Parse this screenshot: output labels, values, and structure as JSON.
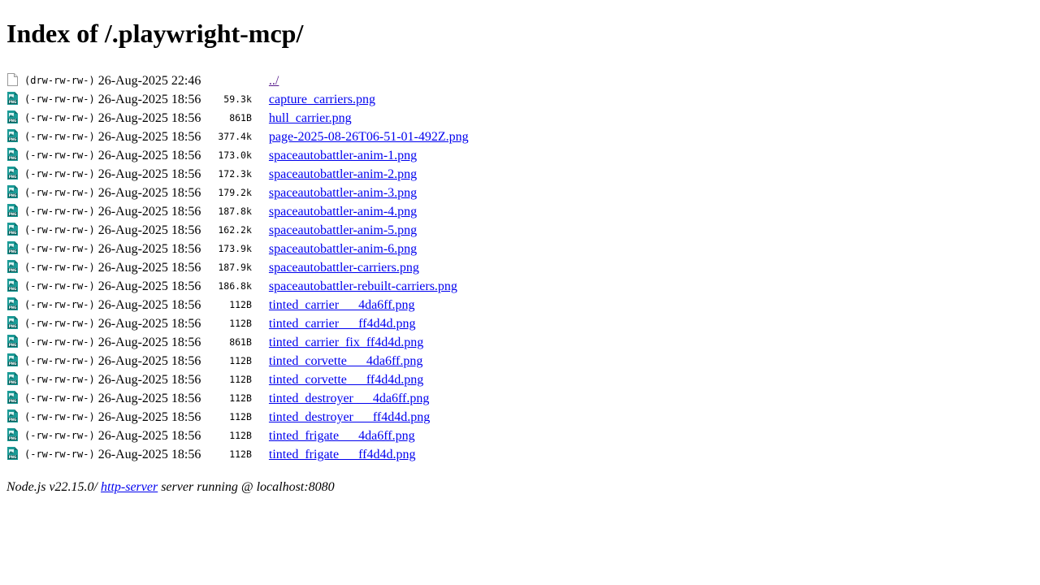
{
  "page": {
    "title": "Index of /.playwright-mcp/"
  },
  "entries": [
    {
      "icon": "folder-file-icon",
      "perms": "(drw-rw-rw-)",
      "date": "26-Aug-2025 22:46",
      "size": "",
      "name": "../",
      "visited": true
    },
    {
      "icon": "png-file-icon",
      "perms": "(-rw-rw-rw-)",
      "date": "26-Aug-2025 18:56",
      "size": "59.3k",
      "name": "capture_carriers.png"
    },
    {
      "icon": "png-file-icon",
      "perms": "(-rw-rw-rw-)",
      "date": "26-Aug-2025 18:56",
      "size": "861B",
      "name": "hull_carrier.png"
    },
    {
      "icon": "png-file-icon",
      "perms": "(-rw-rw-rw-)",
      "date": "26-Aug-2025 18:56",
      "size": "377.4k",
      "name": "page-2025-08-26T06-51-01-492Z.png"
    },
    {
      "icon": "png-file-icon",
      "perms": "(-rw-rw-rw-)",
      "date": "26-Aug-2025 18:56",
      "size": "173.0k",
      "name": "spaceautobattler-anim-1.png"
    },
    {
      "icon": "png-file-icon",
      "perms": "(-rw-rw-rw-)",
      "date": "26-Aug-2025 18:56",
      "size": "172.3k",
      "name": "spaceautobattler-anim-2.png"
    },
    {
      "icon": "png-file-icon",
      "perms": "(-rw-rw-rw-)",
      "date": "26-Aug-2025 18:56",
      "size": "179.2k",
      "name": "spaceautobattler-anim-3.png"
    },
    {
      "icon": "png-file-icon",
      "perms": "(-rw-rw-rw-)",
      "date": "26-Aug-2025 18:56",
      "size": "187.8k",
      "name": "spaceautobattler-anim-4.png"
    },
    {
      "icon": "png-file-icon",
      "perms": "(-rw-rw-rw-)",
      "date": "26-Aug-2025 18:56",
      "size": "162.2k",
      "name": "spaceautobattler-anim-5.png"
    },
    {
      "icon": "png-file-icon",
      "perms": "(-rw-rw-rw-)",
      "date": "26-Aug-2025 18:56",
      "size": "173.9k",
      "name": "spaceautobattler-anim-6.png"
    },
    {
      "icon": "png-file-icon",
      "perms": "(-rw-rw-rw-)",
      "date": "26-Aug-2025 18:56",
      "size": "187.9k",
      "name": "spaceautobattler-carriers.png"
    },
    {
      "icon": "png-file-icon",
      "perms": "(-rw-rw-rw-)",
      "date": "26-Aug-2025 18:56",
      "size": "186.8k",
      "name": "spaceautobattler-rebuilt-carriers.png"
    },
    {
      "icon": "png-file-icon",
      "perms": "(-rw-rw-rw-)",
      "date": "26-Aug-2025 18:56",
      "size": "112B",
      "name": "tinted_carrier___4da6ff.png"
    },
    {
      "icon": "png-file-icon",
      "perms": "(-rw-rw-rw-)",
      "date": "26-Aug-2025 18:56",
      "size": "112B",
      "name": "tinted_carrier___ff4d4d.png"
    },
    {
      "icon": "png-file-icon",
      "perms": "(-rw-rw-rw-)",
      "date": "26-Aug-2025 18:56",
      "size": "861B",
      "name": "tinted_carrier_fix_ff4d4d.png"
    },
    {
      "icon": "png-file-icon",
      "perms": "(-rw-rw-rw-)",
      "date": "26-Aug-2025 18:56",
      "size": "112B",
      "name": "tinted_corvette___4da6ff.png"
    },
    {
      "icon": "png-file-icon",
      "perms": "(-rw-rw-rw-)",
      "date": "26-Aug-2025 18:56",
      "size": "112B",
      "name": "tinted_corvette___ff4d4d.png"
    },
    {
      "icon": "png-file-icon",
      "perms": "(-rw-rw-rw-)",
      "date": "26-Aug-2025 18:56",
      "size": "112B",
      "name": "tinted_destroyer___4da6ff.png"
    },
    {
      "icon": "png-file-icon",
      "perms": "(-rw-rw-rw-)",
      "date": "26-Aug-2025 18:56",
      "size": "112B",
      "name": "tinted_destroyer___ff4d4d.png"
    },
    {
      "icon": "png-file-icon",
      "perms": "(-rw-rw-rw-)",
      "date": "26-Aug-2025 18:56",
      "size": "112B",
      "name": "tinted_frigate___4da6ff.png"
    },
    {
      "icon": "png-file-icon",
      "perms": "(-rw-rw-rw-)",
      "date": "26-Aug-2025 18:56",
      "size": "112B",
      "name": "tinted_frigate___ff4d4d.png"
    }
  ],
  "footer": {
    "prefix": "Node.js v22.15.0/ ",
    "link": "http-server",
    "suffix": " server running @ localhost:8080"
  },
  "colors": {
    "link": "#0000ee",
    "visited_link": "#551a8b",
    "png_icon_teal": "#1a9a96"
  }
}
